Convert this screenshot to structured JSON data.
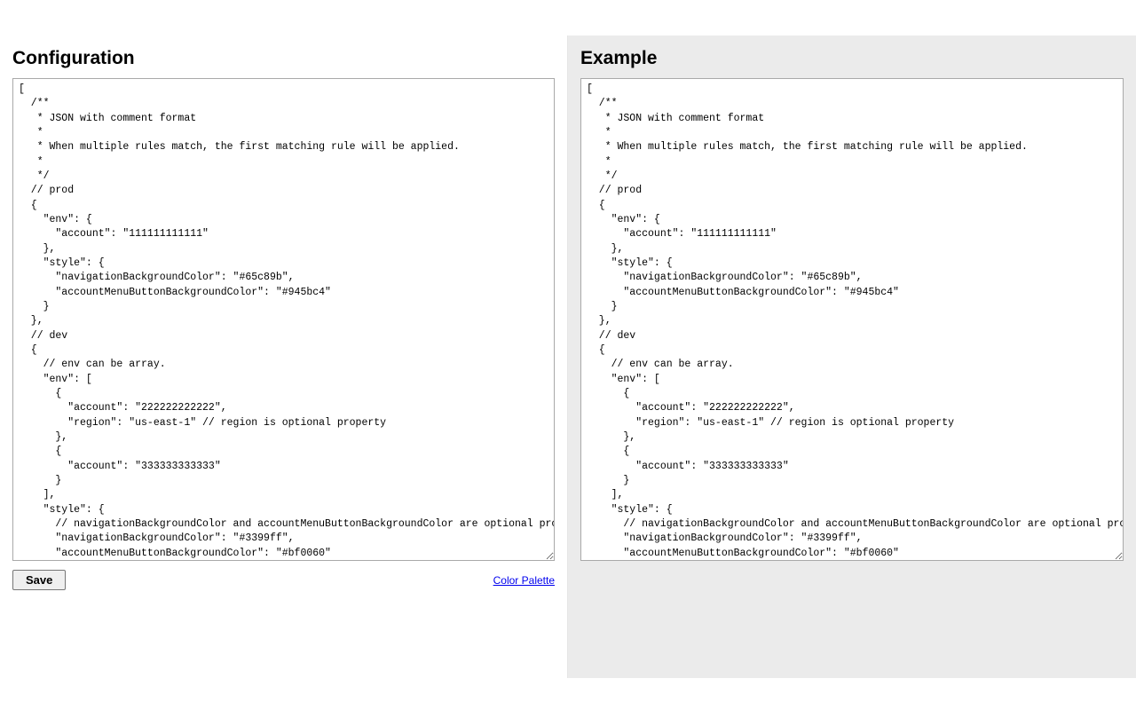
{
  "left": {
    "title": "Configuration",
    "code": "[\n  /**\n   * JSON with comment format\n   *\n   * When multiple rules match, the first matching rule will be applied.\n   *\n   */\n  // prod\n  {\n    \"env\": {\n      \"account\": \"111111111111\"\n    },\n    \"style\": {\n      \"navigationBackgroundColor\": \"#65c89b\",\n      \"accountMenuButtonBackgroundColor\": \"#945bc4\"\n    }\n  },\n  // dev\n  {\n    // env can be array.\n    \"env\": [\n      {\n        \"account\": \"222222222222\",\n        \"region\": \"us-east-1\" // region is optional property\n      },\n      {\n        \"account\": \"333333333333\"\n      }\n    ],\n    \"style\": {\n      // navigationBackgroundColor and accountMenuButtonBackgroundColor are optional properties.\n      \"navigationBackgroundColor\": \"#3399ff\",\n      \"accountMenuButtonBackgroundColor\": \"#bf0060\"\n    }\n  }\n]",
    "save_label": "Save",
    "palette_label": "Color Palette"
  },
  "right": {
    "title": "Example",
    "code": "[\n  /**\n   * JSON with comment format\n   *\n   * When multiple rules match, the first matching rule will be applied.\n   *\n   */\n  // prod\n  {\n    \"env\": {\n      \"account\": \"111111111111\"\n    },\n    \"style\": {\n      \"navigationBackgroundColor\": \"#65c89b\",\n      \"accountMenuButtonBackgroundColor\": \"#945bc4\"\n    }\n  },\n  // dev\n  {\n    // env can be array.\n    \"env\": [\n      {\n        \"account\": \"222222222222\",\n        \"region\": \"us-east-1\" // region is optional property\n      },\n      {\n        \"account\": \"333333333333\"\n      }\n    ],\n    \"style\": {\n      // navigationBackgroundColor and accountMenuButtonBackgroundColor are optional properties.\n      \"navigationBackgroundColor\": \"#3399ff\",\n      \"accountMenuButtonBackgroundColor\": \"#bf0060\"\n    }\n  }\n]"
  }
}
